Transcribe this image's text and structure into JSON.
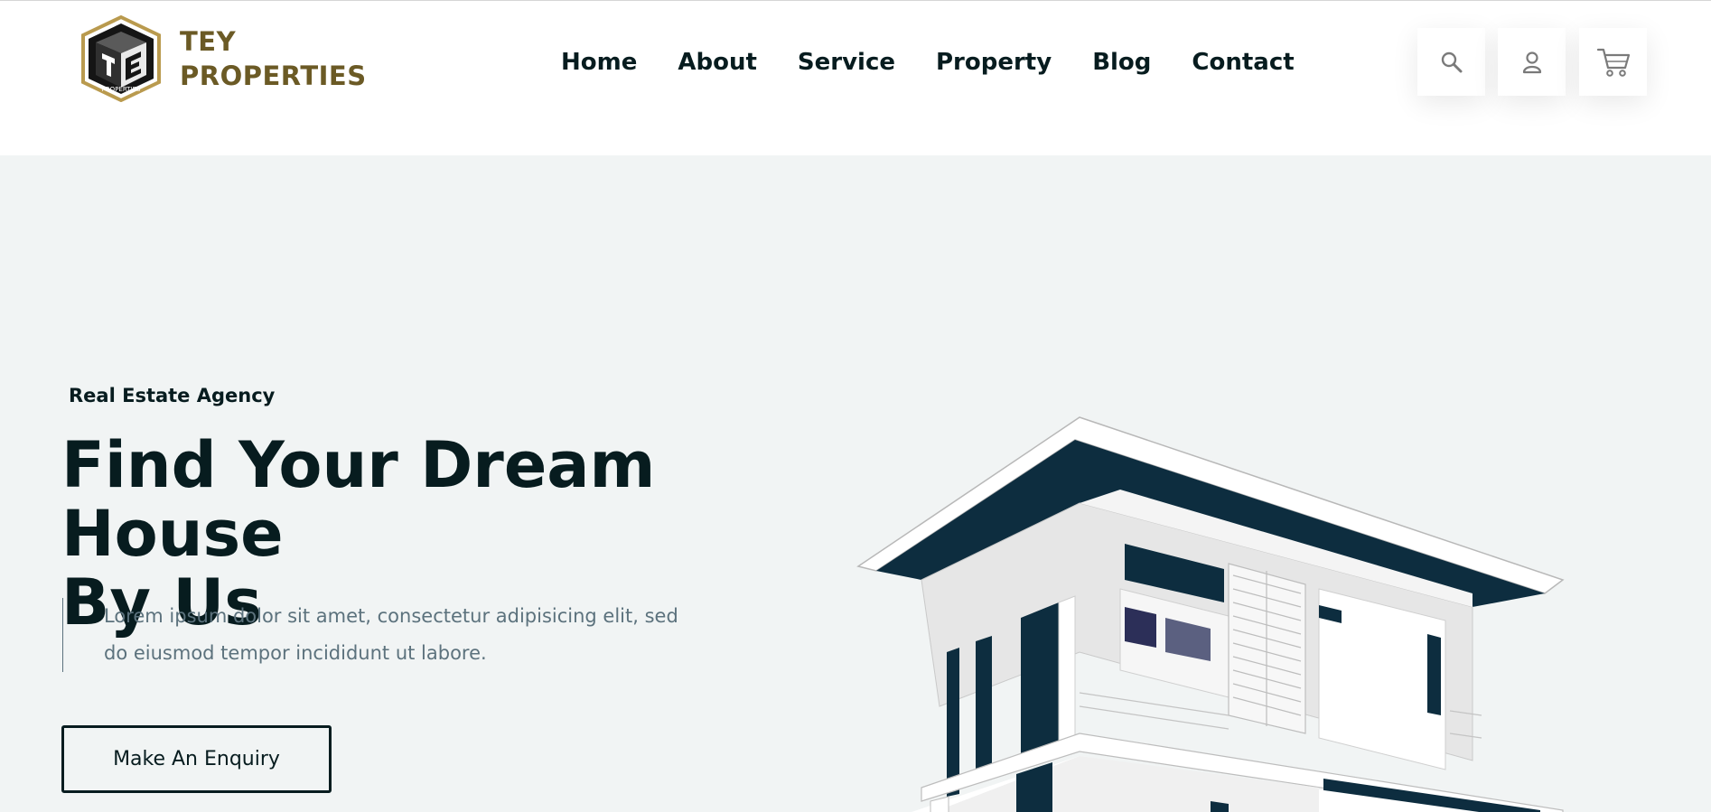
{
  "brand": {
    "line1": "TEY",
    "line2": "PROPERTIES",
    "logo_text": "PROPERTIES",
    "logo_icon": "tey-logo-icon",
    "color": "#6b5a25"
  },
  "nav": {
    "items": [
      {
        "label": "Home"
      },
      {
        "label": "About"
      },
      {
        "label": "Service"
      },
      {
        "label": "Property"
      },
      {
        "label": "Blog"
      },
      {
        "label": "Contact"
      }
    ]
  },
  "actions": {
    "search_icon": "search-icon",
    "user_icon": "user-icon",
    "cart_icon": "cart-icon"
  },
  "hero": {
    "tagline": "Real Estate Agency",
    "title_line1": "Find Your Dream House",
    "title_line2": "By Us",
    "desc_line1": "Lorem ipsum dolor sit amet, consectetur adipisicing elit, sed",
    "desc_line2": "do eiusmod tempor incididunt ut labore.",
    "button": "Make An Enquiry",
    "image_icon": "house-illustration"
  },
  "colors": {
    "dark": "#071c1f",
    "muted": "#5c727d",
    "hero_bg": "#f1f4f4",
    "accent_navy": "#0d2d3f"
  }
}
